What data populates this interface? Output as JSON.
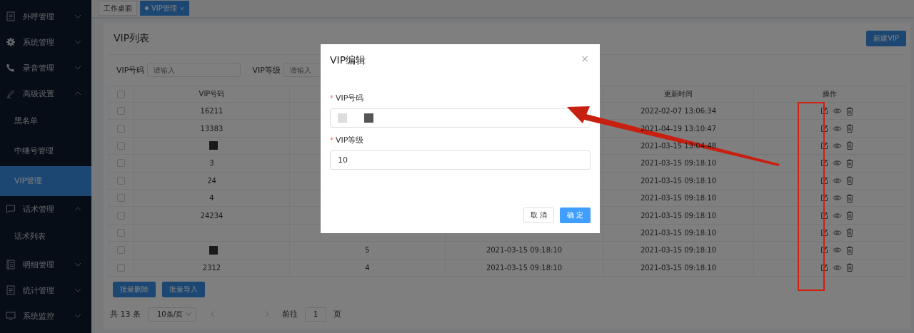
{
  "sidebar": {
    "items": [
      {
        "label": "外呼管理",
        "expanded": false
      },
      {
        "label": "系统管理",
        "expanded": false
      },
      {
        "label": "录音管理",
        "expanded": false
      },
      {
        "label": "高级设置",
        "expanded": true,
        "children": [
          {
            "label": "黑名单",
            "selected": false
          },
          {
            "label": "中继号管理",
            "selected": false
          },
          {
            "label": "VIP管理",
            "selected": true
          }
        ]
      },
      {
        "label": "话术管理",
        "expanded": true,
        "children": [
          {
            "label": "话术列表",
            "selected": false
          }
        ]
      },
      {
        "label": "明细管理",
        "expanded": false
      },
      {
        "label": "统计管理",
        "expanded": false
      },
      {
        "label": "系统监控",
        "expanded": false
      }
    ]
  },
  "tabs": [
    {
      "label": "工作桌面",
      "selected": false
    },
    {
      "label": "VIP管理",
      "selected": true,
      "closable": true
    }
  ],
  "page": {
    "title": "VIP列表",
    "new_button": "新建VIP",
    "filters": [
      {
        "label": "VIP号码",
        "placeholder": "请输入"
      },
      {
        "label": "VIP等级",
        "placeholder": "请输入"
      }
    ],
    "table": {
      "select_all_checked": false,
      "columns": {
        "vip_number": "VIP号码",
        "updated": "更新时间",
        "actions": "操作"
      },
      "rows": [
        {
          "checked": false,
          "vip_number": "16211",
          "updated": "2022-02-07 13:06:34"
        },
        {
          "checked": false,
          "vip_number": "13383",
          "updated": "2021-04-19 13:10:47"
        },
        {
          "checked": false,
          "redacted": true,
          "updated": "2021-03-15 13:04:48"
        },
        {
          "checked": false,
          "vip_number": "3",
          "updated": "2021-03-15 09:18:10"
        },
        {
          "checked": false,
          "vip_number": "24",
          "updated": "2021-03-15 09:18:10"
        },
        {
          "checked": false,
          "vip_number": "4",
          "updated": "2021-03-15 09:18:10"
        },
        {
          "checked": false,
          "vip_number": "24234",
          "updated": "2021-03-15 09:18:10"
        },
        {
          "checked": false,
          "updated": "2021-03-15 09:18:10"
        },
        {
          "checked": false,
          "redacted": true,
          "level": "5",
          "created": "2021-03-15 09:18:10",
          "updated": "2021-03-15 09:18:10"
        },
        {
          "checked": false,
          "vip_number": "2312",
          "level": "4",
          "created": "2021-03-15 09:18:10",
          "updated": "2021-03-15 09:18:10"
        }
      ]
    },
    "bulk_buttons": [
      "批量删除",
      "批量导入"
    ],
    "pagination": {
      "total": "共 13 条",
      "page_size": "10条/页",
      "goto_label": "前往",
      "goto_value": "1",
      "goto_suffix": "页"
    }
  },
  "dialog": {
    "title": "VIP编辑",
    "close": "×",
    "fields": [
      {
        "label": "VIP号码",
        "required_mark": "*",
        "redacted": true
      },
      {
        "label": "VIP等级",
        "required_mark": "*",
        "value": "10"
      }
    ],
    "buttons": [
      {
        "label": "取 消",
        "kind": "secondary"
      },
      {
        "label": "确 定",
        "kind": "primary"
      }
    ]
  },
  "annotation": {
    "arrow": true,
    "highlight_box": true
  }
}
